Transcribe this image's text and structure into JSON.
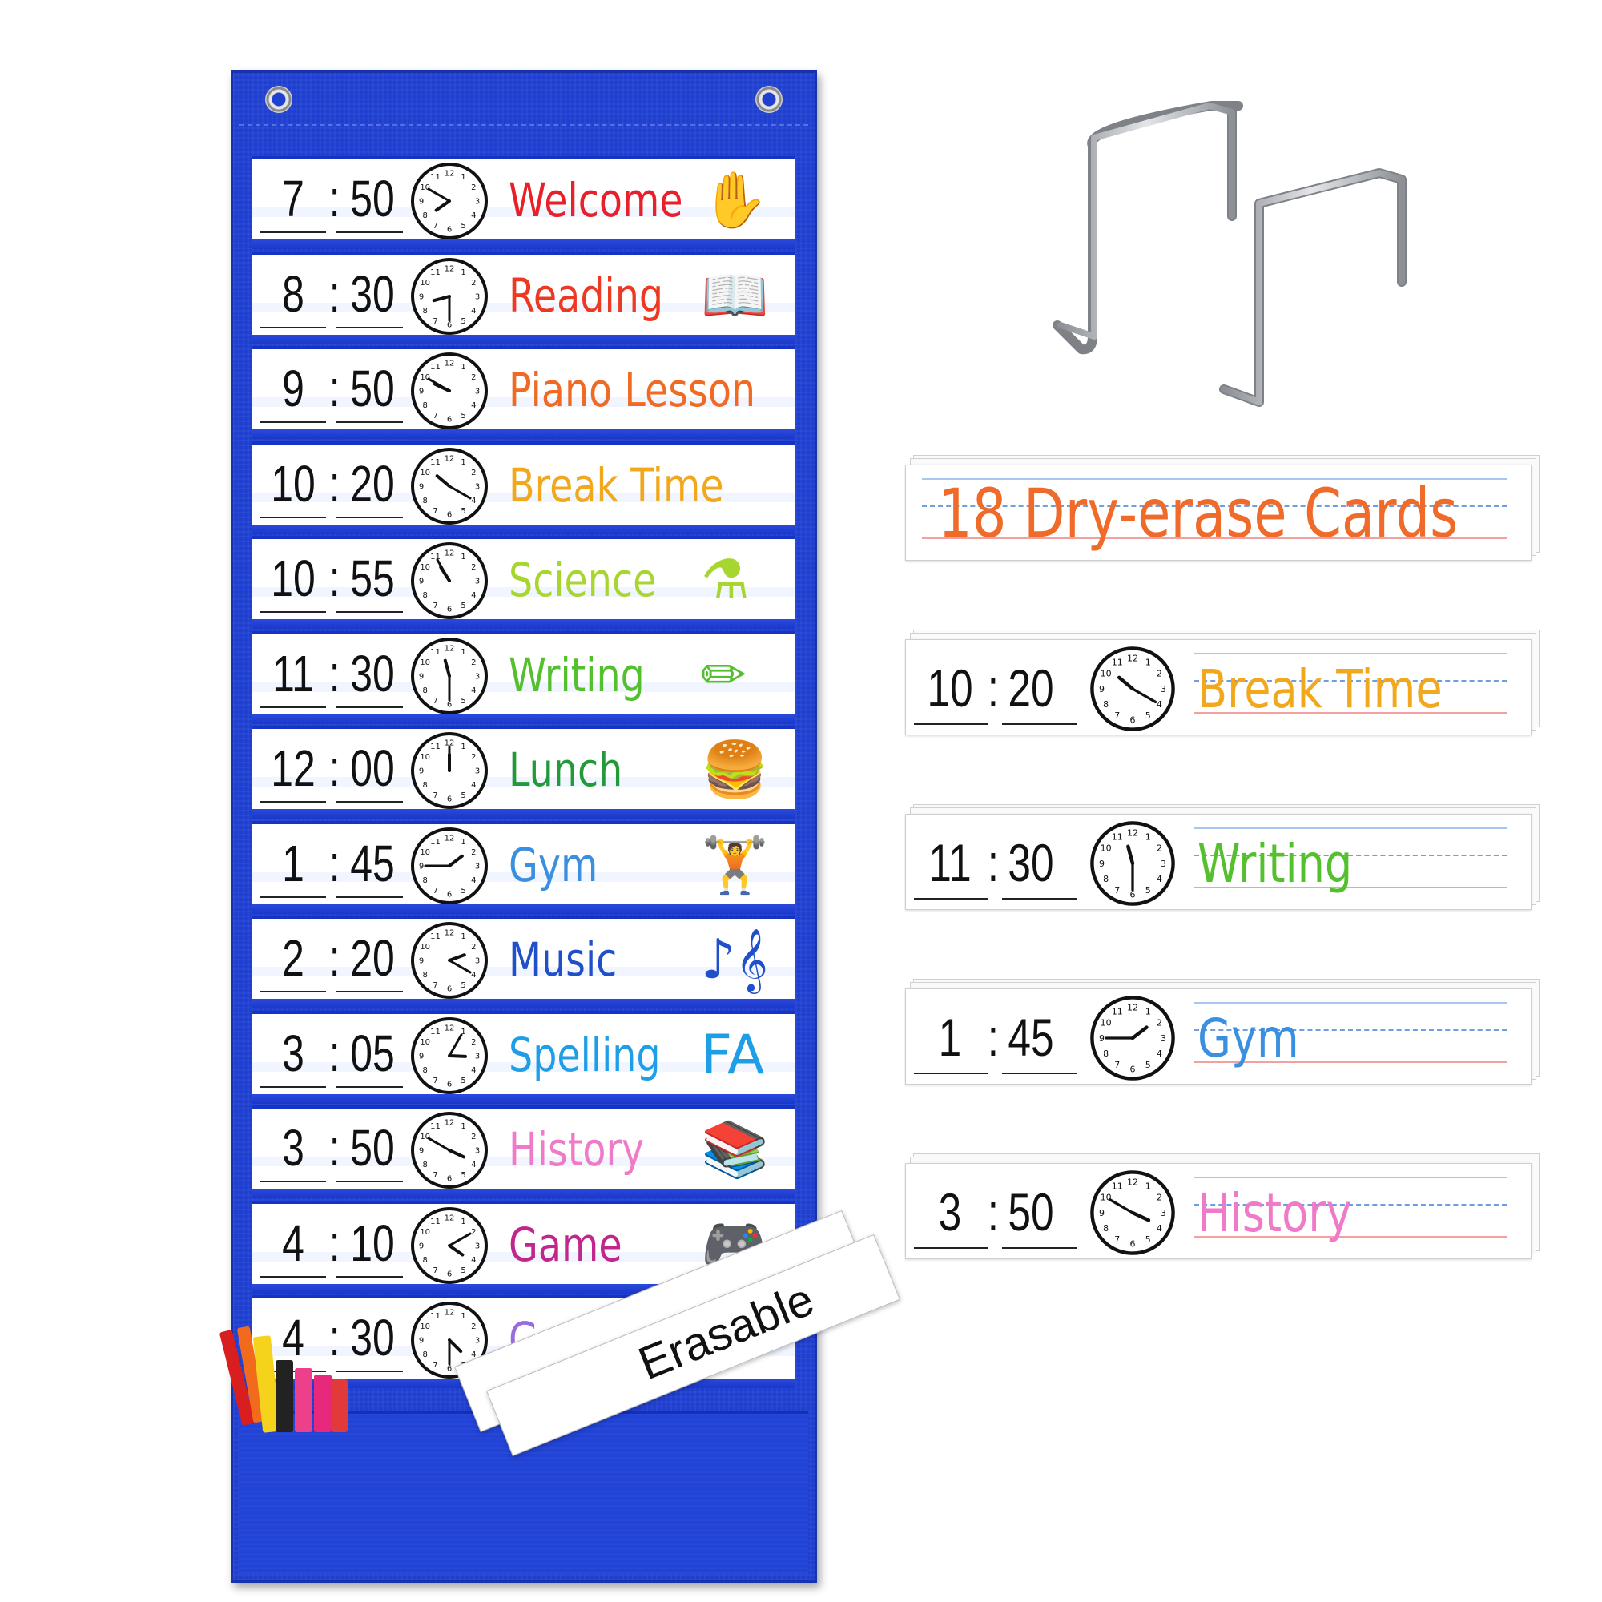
{
  "schedule": [
    {
      "hour": "7",
      "minute": "50",
      "activity": "Welcome",
      "color": "#e8202a",
      "icon": "✋",
      "icon_name": "hand-icon",
      "h": 7.833
    },
    {
      "hour": "8",
      "minute": "30",
      "activity": "Reading",
      "color": "#ec3a22",
      "icon": "📖",
      "icon_name": "book-icon",
      "h": 8.5
    },
    {
      "hour": "9",
      "minute": "50",
      "activity": "Piano Lesson",
      "color": "#f06a24",
      "icon": "",
      "icon_name": "",
      "h": 9.833
    },
    {
      "hour": "10",
      "minute": "20",
      "activity": "Break Time",
      "color": "#f2a81c",
      "icon": "",
      "icon_name": "",
      "h": 10.333
    },
    {
      "hour": "10",
      "minute": "55",
      "activity": "Science",
      "color": "#a8d631",
      "icon": "⚗",
      "icon_name": "flask-icon",
      "h": 10.917
    },
    {
      "hour": "11",
      "minute": "30",
      "activity": "Writing",
      "color": "#54c02e",
      "icon": "✏",
      "icon_name": "pencil-icon",
      "h": 11.5
    },
    {
      "hour": "12",
      "minute": "00",
      "activity": "Lunch",
      "color": "#239a3a",
      "icon": "🍔",
      "icon_name": "burger-icon",
      "h": 12.0
    },
    {
      "hour": "1",
      "minute": "45",
      "activity": "Gym",
      "color": "#3a8fe0",
      "icon": "🏋",
      "icon_name": "dumbbell-icon",
      "h": 1.75
    },
    {
      "hour": "2",
      "minute": "20",
      "activity": "Music",
      "color": "#1f4fc9",
      "icon": "♪𝄞",
      "icon_name": "music-notes-icon",
      "h": 2.333
    },
    {
      "hour": "3",
      "minute": "05",
      "activity": "Spelling",
      "color": "#1f9ee8",
      "icon": "FA",
      "icon_name": "letters-icon",
      "h": 3.083
    },
    {
      "hour": "3",
      "minute": "50",
      "activity": "History",
      "color": "#ee7ac8",
      "icon": "📚",
      "icon_name": "books-icon",
      "h": 3.833
    },
    {
      "hour": "4",
      "minute": "10",
      "activity": "Game",
      "color": "#c0268c",
      "icon": "🎮",
      "icon_name": "game-console-icon",
      "h": 4.167
    },
    {
      "hour": "4",
      "minute": "30",
      "activity": "Go Home",
      "color": "#9a6be0",
      "icon": "",
      "icon_name": "",
      "h": 4.5
    }
  ],
  "loose_card_text": "Erasable",
  "side_title": "18 Dry-erase Cards",
  "side_cards": [
    {
      "hour": "10",
      "minute": "20",
      "activity": "Break Time",
      "color": "#f2a81c",
      "h": 10.333
    },
    {
      "hour": "11",
      "minute": "30",
      "activity": "Writing",
      "color": "#54c02e",
      "h": 11.5
    },
    {
      "hour": "1",
      "minute": "45",
      "activity": "Gym",
      "color": "#3a8fe0",
      "h": 1.75
    },
    {
      "hour": "3",
      "minute": "50",
      "activity": "History",
      "color": "#ee7ac8",
      "h": 3.833
    }
  ],
  "colors": {
    "chart_blue": "#1f3fd0",
    "title_orange": "#f06a2a",
    "hook_gray": "#a9acb1"
  }
}
